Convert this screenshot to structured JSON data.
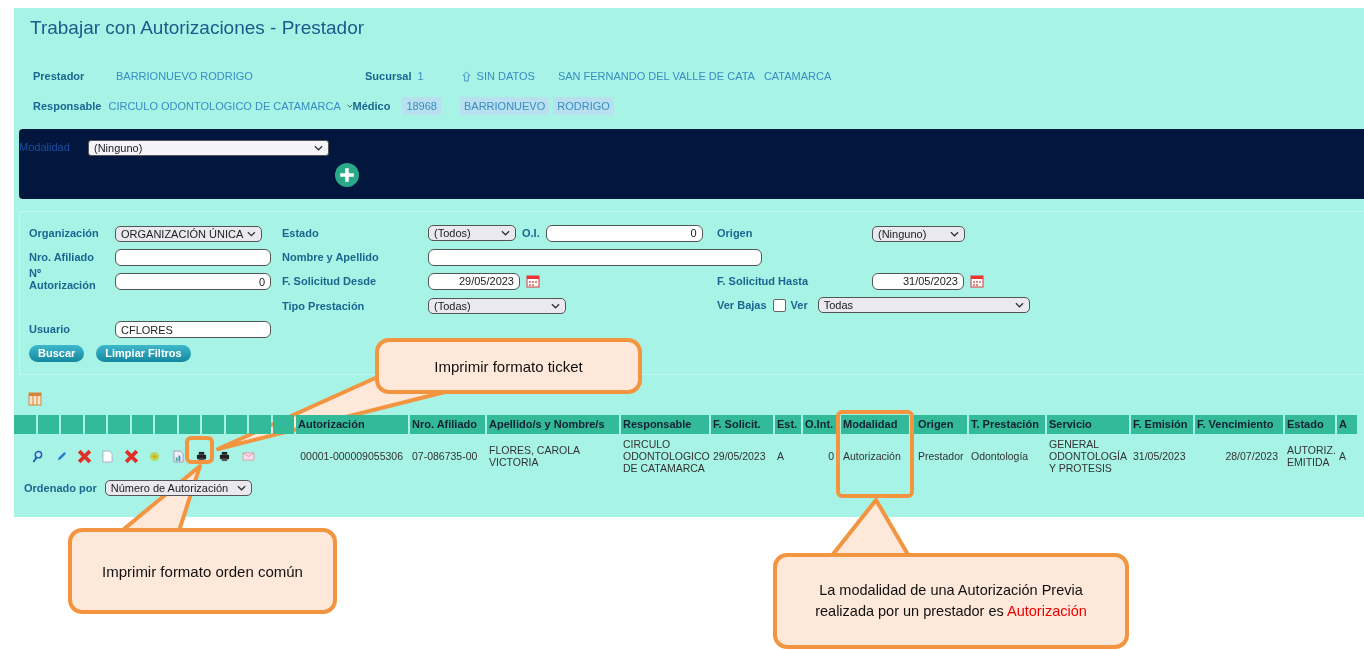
{
  "title": "Trabajar con Autorizaciones - Prestador",
  "provider": {
    "prestador_label": "Prestador",
    "prestador": "BARRIONUEVO RODRIGO",
    "sucursal_label": "Sucursal",
    "sucursal": "1",
    "sucursal_estado": "SIN DATOS",
    "localidad": "SAN FERNANDO DEL VALLE DE CATA",
    "provincia": "CATAMARCA",
    "responsable_label": "Responsable",
    "responsable": "CIRCULO ODONTOLOGICO DE CATAMARCA",
    "medico_label": "Médico",
    "medico_codigo": "18968",
    "medico_apellido": "BARRIONUEVO",
    "medico_nombre": "RODRIGO"
  },
  "modalidad": {
    "label": "Modalidad",
    "value": "(Ninguno)"
  },
  "filters": {
    "organizacion": {
      "label": "Organización",
      "value": "ORGANIZACIÓN ÚNICA"
    },
    "estado": {
      "label": "Estado",
      "value": "(Todos)"
    },
    "oi": {
      "label": "O.I.",
      "value": "0"
    },
    "origen": {
      "label": "Origen",
      "value": "(Ninguno)"
    },
    "nro_afiliado": {
      "label": "Nro. Afiliado"
    },
    "nombre_apellido": {
      "label": "Nombre y Apellido"
    },
    "nro_autorizacion": {
      "label": "Nº Autorización",
      "value": "0"
    },
    "fecha_desde": {
      "label": "F. Solicitud Desde",
      "value": "29/05/2023"
    },
    "fecha_hasta": {
      "label": "F. Solicitud Hasta",
      "value": "31/05/2023"
    },
    "tipo_prestacion": {
      "label": "Tipo Prestación",
      "value": "(Todas)"
    },
    "ver_bajas": {
      "label": "Ver Bajas",
      "checked": false
    },
    "ver": {
      "label": "Ver",
      "value": "Todas"
    },
    "usuario": {
      "label": "Usuario",
      "value": "CFLORES"
    }
  },
  "buttons": [
    "Buscar",
    "Limpiar Filtros"
  ],
  "table": {
    "columns": [
      "Autorización",
      "Nro. Afiliado",
      "Apellido/s y Nombre/s",
      "Responsable",
      "F. Solicit.",
      "Est.",
      "O.Int.",
      "Modalidad",
      "Origen",
      "T. Prestación",
      "Servicio",
      "F. Emisión",
      "F. Vencimiento",
      "Estado",
      "A"
    ],
    "rows": [
      {
        "cells": [
          "00001-000009055306",
          "07-086735-00",
          "FLORES, CAROLA VICTORIA",
          "CIRCULO ODONTOLOGICO DE CATAMARCA",
          "29/05/2023",
          "A",
          "0",
          "Autorización",
          "Prestador",
          "Odontología",
          "GENERAL ODONTOLOGÍA Y PROTESIS",
          "31/05/2023",
          "28/07/2023",
          "AUTORIZ. EMITIDA",
          "A"
        ]
      }
    ]
  },
  "ordenado_por": {
    "label": "Ordenado por",
    "value": "Número de Autorización"
  },
  "callouts": [
    {
      "text": "Imprimir formato ticket"
    },
    {
      "text": "Imprimir formato orden común"
    },
    {
      "text": "La modalidad de una Autorización Previa realizada por un prestador es",
      "highlight": "Autorización"
    }
  ]
}
